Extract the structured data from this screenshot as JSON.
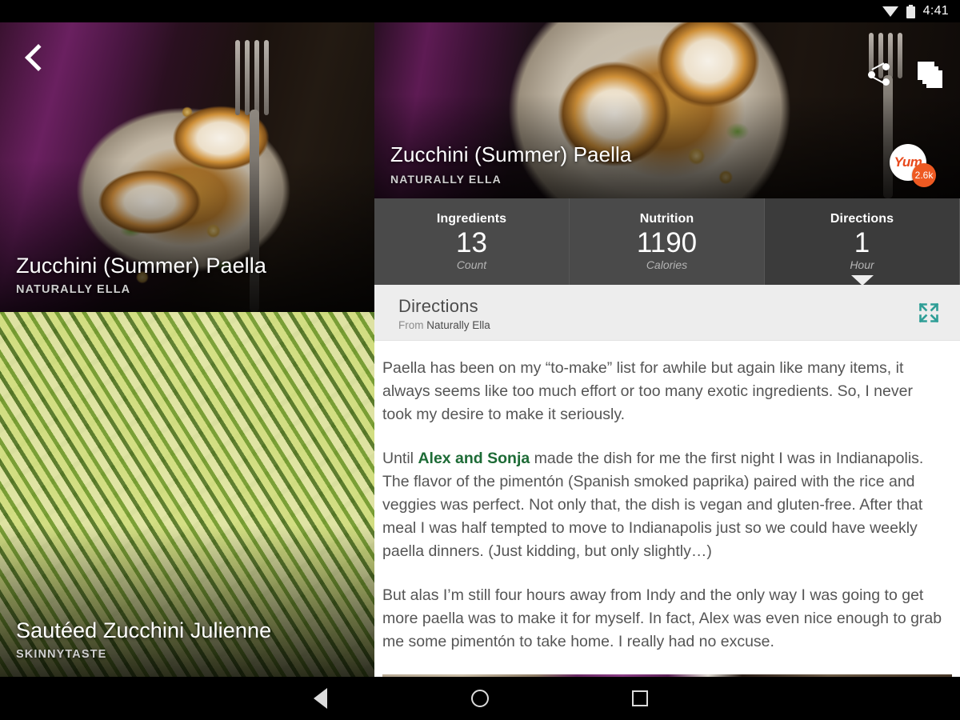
{
  "statusbar": {
    "time": "4:41",
    "wifi_icon": "wifi-icon",
    "battery_icon": "battery-icon"
  },
  "sidebar": {
    "back_icon": "back-chevron-icon",
    "cards": [
      {
        "title": "Zucchini (Summer) Paella",
        "source": "NATURALLY ELLA"
      },
      {
        "title": "Sautéed Zucchini Julienne",
        "source": "SKINNYTASTE"
      }
    ]
  },
  "hero": {
    "title": "Zucchini (Summer) Paella",
    "source": "NATURALLY ELLA",
    "share_icon": "share-icon",
    "stack_icon": "stack-cards-icon",
    "yum_label": "Yum",
    "yum_count": "2.6k"
  },
  "tabs": [
    {
      "label": "Ingredients",
      "value": "13",
      "unit": "Count",
      "active": false
    },
    {
      "label": "Nutrition",
      "value": "1190",
      "unit": "Calories",
      "active": false
    },
    {
      "label": "Directions",
      "value": "1",
      "unit": "Hour",
      "active": true
    }
  ],
  "directions": {
    "title": "Directions",
    "from_prefix": "From",
    "from_source": "Naturally Ella",
    "expand_icon": "expand-fullscreen-icon",
    "paragraphs": [
      {
        "segments": [
          {
            "text": "Paella has been on my “to-make” list for awhile but again like many items, it always seems like too much effort or too many exotic ingredients.  So, I never took my desire to make it seriously.",
            "link": false
          }
        ]
      },
      {
        "segments": [
          {
            "text": "Until ",
            "link": false
          },
          {
            "text": "Alex and Sonja",
            "link": true
          },
          {
            "text": " made the dish for me the first night I was in Indianapolis.  The flavor of the pimentón (Spanish smoked paprika) paired with the rice and veggies was perfect.  Not only that, the dish is vegan and gluten-free.  After that meal I was half tempted to move to Indianapolis just so we could have weekly paella dinners.  (Just kidding, but only slightly…)",
            "link": false
          }
        ]
      },
      {
        "segments": [
          {
            "text": "But alas I’m still four hours away from Indy and the only way I was going to get more paella was to make it for myself.  In fact, Alex was even nice enough to grab me some pimentón to take home.  I really had no excuse.",
            "link": false
          }
        ]
      }
    ]
  },
  "navbar": {
    "back_icon": "nav-back-icon",
    "home_icon": "nav-home-icon",
    "recents_icon": "nav-recents-icon"
  },
  "colors": {
    "accent_teal": "#2f9e96",
    "link_green": "#1d6b36",
    "yum_orange": "#ee5a22",
    "tab_bg": "#4a4a4a",
    "tab_active_bg": "#3b3b3b",
    "panel_bg": "#ededed"
  }
}
